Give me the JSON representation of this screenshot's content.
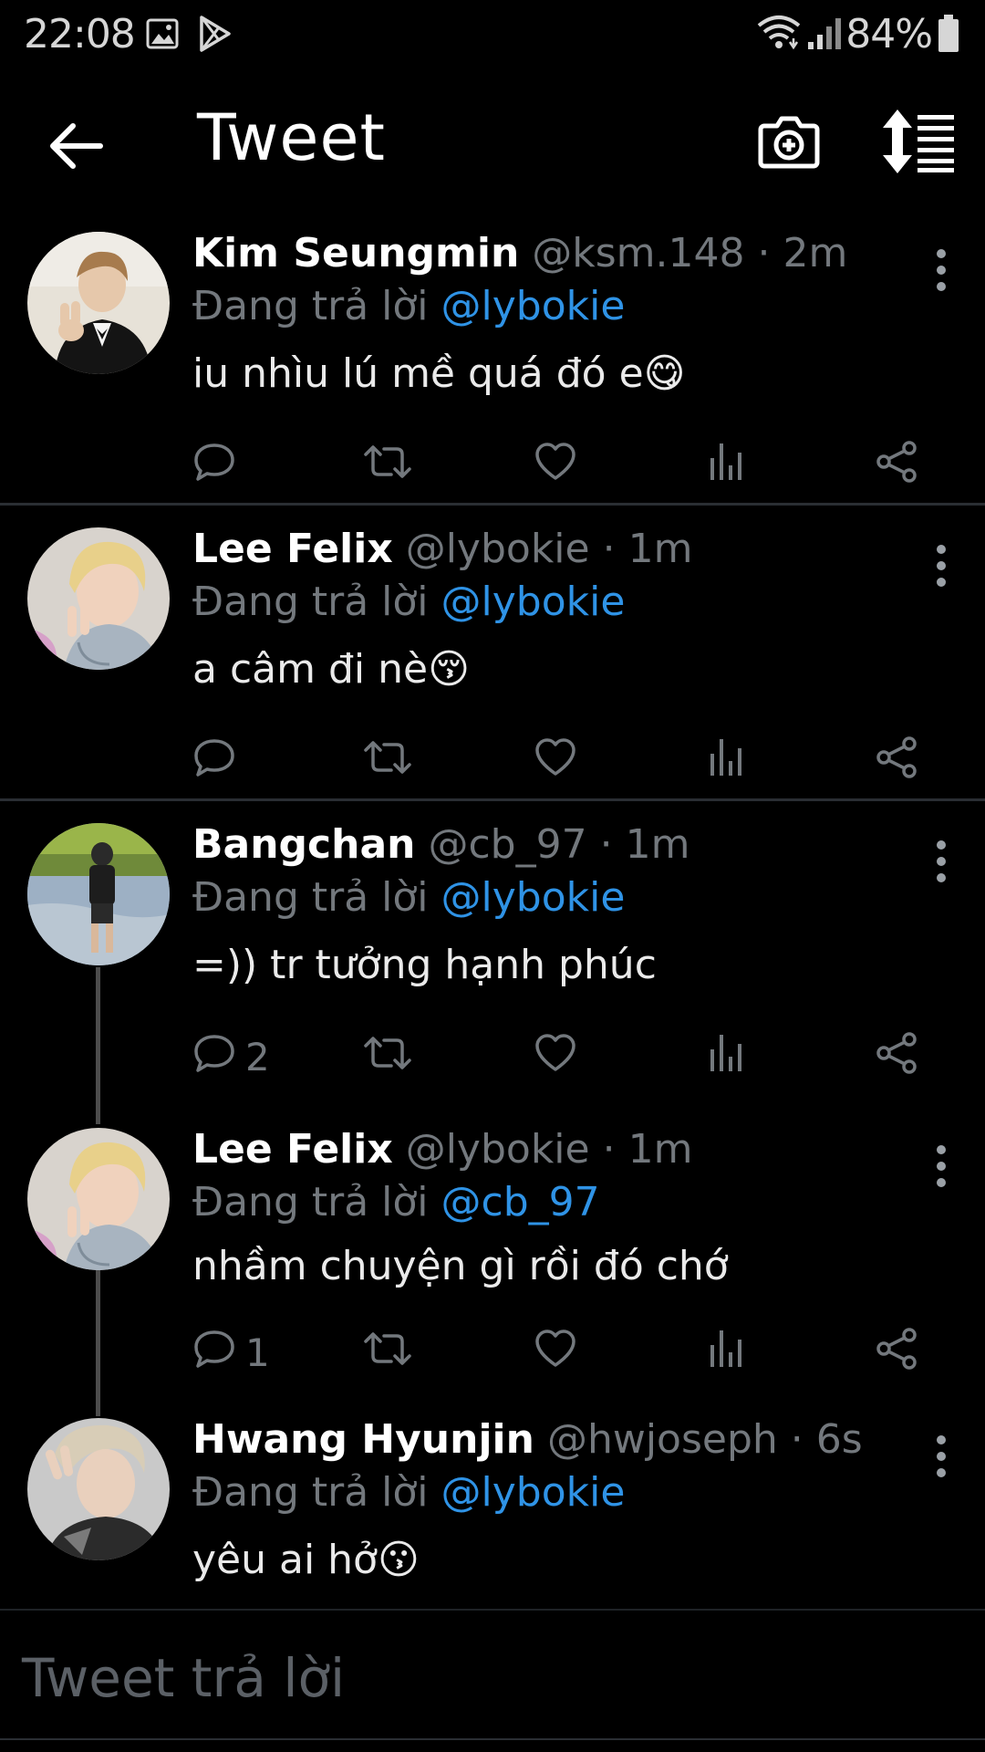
{
  "status_bar": {
    "time": "22:08",
    "battery": "84%",
    "left_icons": [
      "image-icon",
      "play-store-icon"
    ],
    "right_icons": [
      "wifi-icon",
      "signal-icon",
      "battery-icon"
    ]
  },
  "app_bar": {
    "title": "Tweet",
    "back_icon": "arrow-left-icon",
    "camera_icon": "camera-plus-icon",
    "sort_icon": "sort-icon"
  },
  "reply_prefix": "Đang trả lời",
  "tweets": [
    {
      "name": "Kim Seungmin",
      "handle": "@ksm.148",
      "separator": "·",
      "time": "2m",
      "reply_to": "@lybokie",
      "text": "iu nhìu lú mề quá đó e",
      "emoji": "😋",
      "reply_count": ""
    },
    {
      "name": "Lee Felix",
      "handle": "@lybokie",
      "separator": "·",
      "time": "1m",
      "reply_to": "@lybokie",
      "text": "a câm đi nè",
      "emoji": "😚",
      "reply_count": ""
    },
    {
      "name": "Bangchan",
      "handle": "@cb_97",
      "separator": "·",
      "time": "1m",
      "reply_to": "@lybokie",
      "text": "=)) tr tưởng hạnh phúc",
      "emoji": "",
      "reply_count": "2"
    },
    {
      "name": "Lee Felix",
      "handle": "@lybokie",
      "separator": "·",
      "time": "1m",
      "reply_to": "@cb_97",
      "text": "nhầm chuyện gì rồi đó chớ",
      "emoji": "",
      "reply_count": "1"
    },
    {
      "name": "Hwang Hyunjin",
      "handle": "@hwjoseph",
      "separator": "·",
      "time": "6s",
      "reply_to": "@lybokie",
      "text": "yêu ai hở",
      "emoji": "😗",
      "reply_count": ""
    }
  ],
  "action_icons": [
    "reply-icon",
    "retweet-icon",
    "like-icon",
    "analytics-icon",
    "share-icon"
  ],
  "composer": {
    "placeholder": "Tweet trả lời"
  },
  "colors": {
    "background": "#000000",
    "accent": "#2f93e6",
    "muted": "#73787d",
    "divider": "#2a2e33"
  }
}
